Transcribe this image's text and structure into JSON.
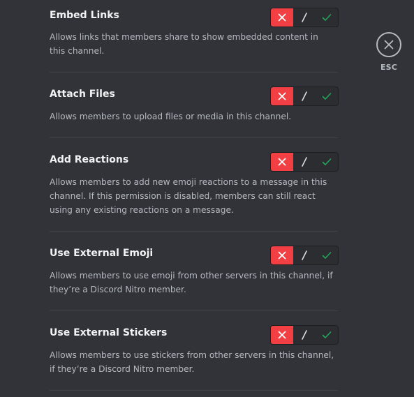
{
  "close": {
    "label": "ESC",
    "icon": "close-icon"
  },
  "toggle_icons": {
    "deny": "x-icon",
    "neutral": "slash-icon",
    "allow": "check-icon"
  },
  "colors": {
    "background": "#313338",
    "deny_active": "#f23f43",
    "allow_check": "#23a55a",
    "toggle_bg": "#2b2d31"
  },
  "permissions": [
    {
      "title": "Embed Links",
      "description": "Allows links that members share to show embedded content in this channel.",
      "state": "deny"
    },
    {
      "title": "Attach Files",
      "description": "Allows members to upload files or media in this channel.",
      "state": "deny"
    },
    {
      "title": "Add Reactions",
      "description": "Allows members to add new emoji reactions to a message in this channel. If this permission is disabled, members can still react using any existing reactions on a message.",
      "state": "deny"
    },
    {
      "title": "Use External Emoji",
      "description": "Allows members to use emoji from other servers in this channel, if they’re a Discord Nitro member.",
      "state": "deny"
    },
    {
      "title": "Use External Stickers",
      "description": "Allows members to use stickers from other servers in this channel, if they’re a Discord Nitro member.",
      "state": "deny"
    }
  ]
}
